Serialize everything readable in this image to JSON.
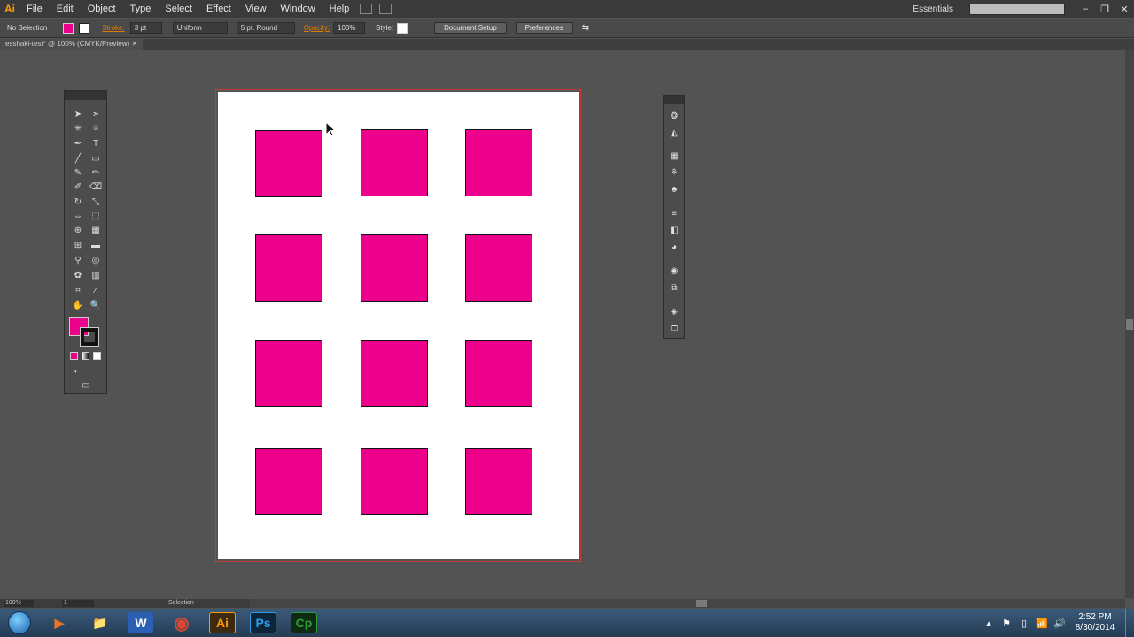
{
  "app": {
    "logo": "Ai",
    "title_tab": "esshaki-test* @ 100% (CMYK/Preview)"
  },
  "menu": [
    "File",
    "Edit",
    "Object",
    "Type",
    "Select",
    "Effect",
    "View",
    "Window",
    "Help"
  ],
  "workspace": "Essentials",
  "window_controls": [
    "–",
    "❐",
    "✕"
  ],
  "control_bar": {
    "selection": "No Selection",
    "fill_color": "#ec008c",
    "stroke_label": "Stroke:",
    "stroke_weight": "3 pt",
    "profile": "Uniform",
    "brush": "5 pt. Round",
    "opacity_label": "Opacity:",
    "opacity_value": "100%",
    "style_label": "Style:",
    "document_setup": "Document Setup",
    "preferences": "Preferences"
  },
  "artboard": {
    "square_count": 12,
    "square_color": "#ec008c"
  },
  "status": {
    "zoom": "100%",
    "artboard_num": "1",
    "tool": "Selection"
  },
  "taskbar": {
    "apps": [
      {
        "name": "media-player",
        "label": "▶",
        "color": "#e8742a"
      },
      {
        "name": "file-explorer",
        "label": "📁",
        "color": "#e3b54b"
      },
      {
        "name": "word",
        "label": "W",
        "color": "#2b5fb4"
      },
      {
        "name": "chrome",
        "label": "◉",
        "color": "#d94632"
      },
      {
        "name": "illustrator",
        "label": "Ai",
        "color": "#ff9a00"
      },
      {
        "name": "photoshop",
        "label": "Ps",
        "color": "#2f9ae8"
      },
      {
        "name": "captivate",
        "label": "Cp",
        "color": "#2e9e3e"
      }
    ],
    "time": "2:52 PM",
    "date": "8/30/2014"
  }
}
